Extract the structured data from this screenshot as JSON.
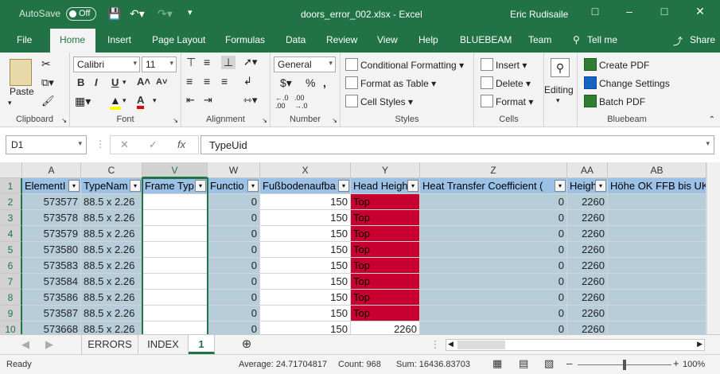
{
  "titlebar": {
    "autosave": "AutoSave",
    "autosave_state": "Off",
    "title": "doors_error_002.xlsx  -  Excel",
    "user": "Eric Rudisaile"
  },
  "tabs": [
    "File",
    "Home",
    "Insert",
    "Page Layout",
    "Formulas",
    "Data",
    "Review",
    "View",
    "Help",
    "BLUEBEAM",
    "Team",
    "Tell me",
    "Share"
  ],
  "ribbon": {
    "clipboard": {
      "label": "Clipboard",
      "paste": "Paste"
    },
    "font": {
      "label": "Font",
      "name": "Calibri",
      "size": "11"
    },
    "alignment": {
      "label": "Alignment"
    },
    "number": {
      "label": "Number",
      "format": "General"
    },
    "styles": {
      "label": "Styles",
      "cond": "Conditional Formatting",
      "table": "Format as Table",
      "cell": "Cell Styles"
    },
    "cells": {
      "label": "Cells",
      "insert": "Insert",
      "delete": "Delete",
      "format": "Format"
    },
    "editing": {
      "label": "Editing"
    },
    "bluebeam": {
      "label": "Bluebeam",
      "create": "Create PDF",
      "change": "Change Settings",
      "batch": "Batch PDF"
    }
  },
  "formula_bar": {
    "name_box": "D1",
    "formula": "TypeUid"
  },
  "columns": [
    "A",
    "C",
    "V",
    "W",
    "X",
    "Y",
    "Z",
    "AA",
    "AB"
  ],
  "headers": [
    "ElementI",
    "TypeNam",
    "Frame Typ",
    "Functio",
    "Fußbodenaufba",
    "Head Heigh",
    "Heat Transfer Coefficient (",
    "Heigh",
    "Höhe OK FFB bis UK"
  ],
  "rows": [
    {
      "n": "2",
      "a": "573577",
      "c": "88.5 x 2.26",
      "w": "0",
      "x": "150",
      "y": "Top",
      "z": "0",
      "aa": "2260"
    },
    {
      "n": "3",
      "a": "573578",
      "c": "88.5 x 2.26",
      "w": "0",
      "x": "150",
      "y": "Top",
      "z": "0",
      "aa": "2260"
    },
    {
      "n": "4",
      "a": "573579",
      "c": "88.5 x 2.26",
      "w": "0",
      "x": "150",
      "y": "Top",
      "z": "0",
      "aa": "2260"
    },
    {
      "n": "5",
      "a": "573580",
      "c": "88.5 x 2.26",
      "w": "0",
      "x": "150",
      "y": "Top",
      "z": "0",
      "aa": "2260"
    },
    {
      "n": "6",
      "a": "573583",
      "c": "88.5 x 2.26",
      "w": "0",
      "x": "150",
      "y": "Top",
      "z": "0",
      "aa": "2260"
    },
    {
      "n": "7",
      "a": "573584",
      "c": "88.5 x 2.26",
      "w": "0",
      "x": "150",
      "y": "Top",
      "z": "0",
      "aa": "2260"
    },
    {
      "n": "8",
      "a": "573586",
      "c": "88.5 x 2.26",
      "w": "0",
      "x": "150",
      "y": "Top",
      "z": "0",
      "aa": "2260"
    },
    {
      "n": "9",
      "a": "573587",
      "c": "88.5 x 2.26",
      "w": "0",
      "x": "150",
      "y": "Top",
      "z": "0",
      "aa": "2260"
    },
    {
      "n": "10",
      "a": "573668",
      "c": "88.5 x 2.26",
      "w": "0",
      "x": "150",
      "y": "2260",
      "z": "0",
      "aa": "2260"
    }
  ],
  "sheets": [
    "ERRORS",
    "INDEX",
    "1"
  ],
  "status": {
    "ready": "Ready",
    "average": "Average: 24.71704817",
    "count": "Count: 968",
    "sum": "Sum: 16436.83703",
    "zoom": "100%"
  },
  "colors": {
    "excel_green": "#217346",
    "header_blue": "#9bc2e6",
    "cell_blue": "#b7cdd9",
    "error_red": "#c8002f"
  }
}
